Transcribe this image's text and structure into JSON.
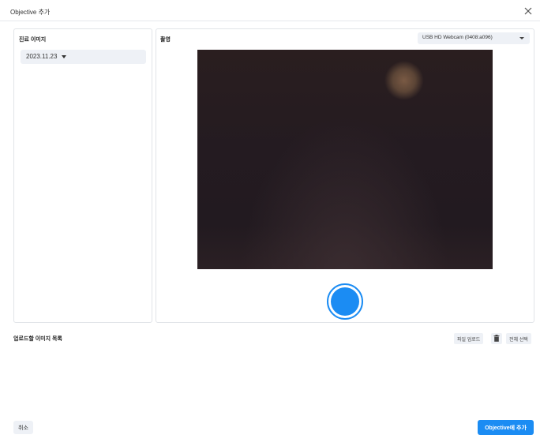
{
  "dialog": {
    "title": "Objective 추가",
    "close_icon": "close-icon"
  },
  "left_panel": {
    "heading": "진료 이미지",
    "date_select": {
      "value": "2023.11.23",
      "icon": "caret-down-icon"
    }
  },
  "capture_panel": {
    "heading": "촬영",
    "camera_select": {
      "value": "USB HD Webcam (0408:a096)",
      "icon": "caret-down-icon"
    },
    "shutter_icon": "shutter-button-icon"
  },
  "upload_list": {
    "heading": "업로드할 이미지 목록",
    "file_upload_label": "파일 업로드",
    "trash_icon": "trash-icon",
    "select_all_label": "전체 선택"
  },
  "footer": {
    "cancel_label": "취소",
    "add_label": "Objective에 추가"
  },
  "colors": {
    "accent": "#1b8cf3",
    "select_bg": "#eef1f6",
    "border": "#e1e4e8"
  }
}
